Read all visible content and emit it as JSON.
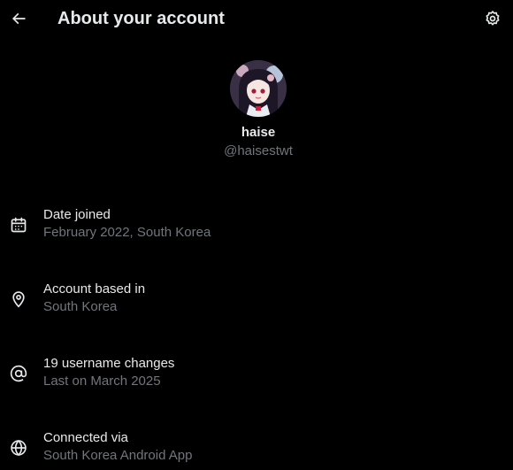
{
  "header": {
    "title": "About your account",
    "back_icon": "arrow-left-icon",
    "settings_icon": "gear-icon"
  },
  "profile": {
    "display_name": "haise",
    "handle": "@haisestwt"
  },
  "info": [
    {
      "icon": "calendar-icon",
      "label": "Date joined",
      "value": "February 2022, South Korea"
    },
    {
      "icon": "location-pin-icon",
      "label": "Account based in",
      "value": "South Korea"
    },
    {
      "icon": "at-sign-icon",
      "label": "19 username changes",
      "value": "Last on March 2025"
    },
    {
      "icon": "globe-icon",
      "label": "Connected via",
      "value": "South Korea Android App"
    }
  ],
  "colors": {
    "background": "#000000",
    "primary_text": "#e7e9ea",
    "secondary_text": "#71767b"
  }
}
